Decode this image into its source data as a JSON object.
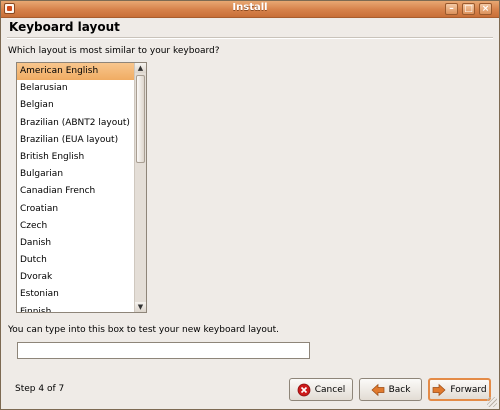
{
  "window": {
    "title": "Install",
    "controls": {
      "minimize": "–",
      "maximize": "□",
      "close": "×"
    }
  },
  "page": {
    "heading": "Keyboard layout",
    "question": "Which layout is most similar to your keyboard?",
    "test_label": "You can type into this box to test your new keyboard layout.",
    "test_value": "",
    "step": "Step 4 of 7"
  },
  "layouts": {
    "selected": "American English",
    "items": [
      "American English",
      "Belarusian",
      "Belgian",
      "Brazilian (ABNT2 layout)",
      "Brazilian (EUA layout)",
      "British English",
      "Bulgarian",
      "Canadian French",
      "Croatian",
      "Czech",
      "Danish",
      "Dutch",
      "Dvorak",
      "Estonian",
      "Finnish"
    ],
    "scroll_position": 0
  },
  "buttons": {
    "cancel": "Cancel",
    "back": "Back",
    "forward": "Forward"
  },
  "colors": {
    "titlebar": "#d6814a",
    "selection": "#f4b774",
    "default_button_border": "#e48b47",
    "cancel_icon": "#cc1a1a",
    "arrow_icon": "#e07a2e"
  }
}
